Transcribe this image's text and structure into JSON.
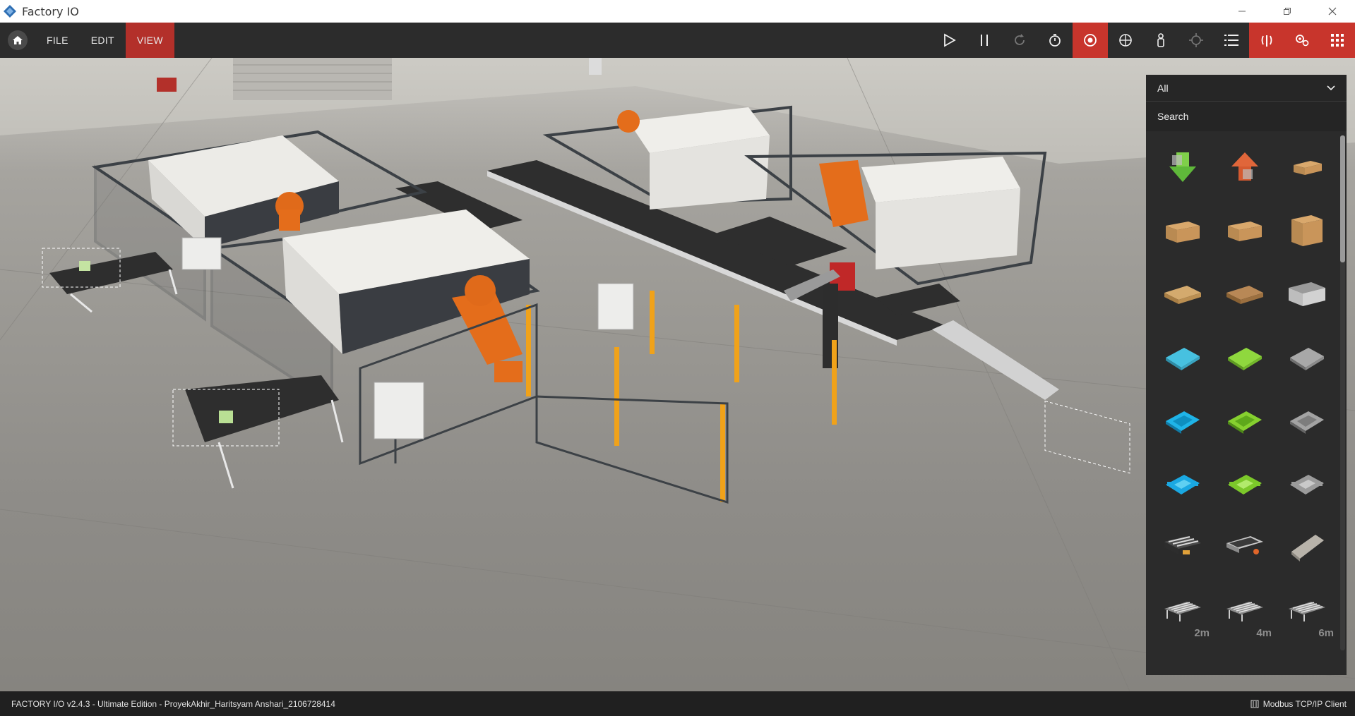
{
  "window": {
    "title": "Factory IO",
    "controls": [
      "minimize-icon",
      "restore-icon",
      "close-icon"
    ]
  },
  "toolbar": {
    "menu": [
      "FILE",
      "EDIT",
      "VIEW"
    ],
    "active_menu": "VIEW",
    "buttons": [
      "play-icon",
      "pause-icon",
      "reset-icon",
      "timer-icon",
      "orbit-camera-icon",
      "fly-camera-icon",
      "first-person-camera-icon",
      "target-icon",
      "scene-list-icon",
      "sensors-icon",
      "drivers-icon",
      "palette-icon"
    ],
    "accent": "#c8352c"
  },
  "palette": {
    "filter_value": "All",
    "search_placeholder": "Search",
    "parts": [
      {
        "icon": "remover-icon"
      },
      {
        "icon": "emitter-icon"
      },
      {
        "icon": "small-box-icon"
      },
      {
        "icon": "medium-box-icon"
      },
      {
        "icon": "medium-box-2-icon"
      },
      {
        "icon": "large-box-icon"
      },
      {
        "icon": "pallet-icon"
      },
      {
        "icon": "pallet-2-icon"
      },
      {
        "icon": "stackable-box-icon"
      },
      {
        "icon": "blue-raw-material-icon"
      },
      {
        "icon": "green-raw-material-icon"
      },
      {
        "icon": "metal-raw-material-icon"
      },
      {
        "icon": "blue-product-base-icon"
      },
      {
        "icon": "green-product-base-icon"
      },
      {
        "icon": "metal-product-base-icon"
      },
      {
        "icon": "blue-product-lid-icon"
      },
      {
        "icon": "green-product-lid-icon"
      },
      {
        "icon": "metal-product-lid-icon"
      },
      {
        "icon": "roller-conveyor-icon"
      },
      {
        "icon": "belt-conveyor-icon"
      },
      {
        "icon": "metal-plate-icon"
      },
      {
        "icon": "roller-conveyor-2m-icon",
        "label": "2m"
      },
      {
        "icon": "roller-conveyor-4m-icon",
        "label": "4m"
      },
      {
        "icon": "roller-conveyor-6m-icon",
        "label": "6m"
      }
    ]
  },
  "status": {
    "text": "FACTORY I/O v2.4.3 - Ultimate Edition - ProyekAkhir_Haritsyam Anshari_2106728414",
    "driver": "Modbus TCP/IP Client"
  }
}
